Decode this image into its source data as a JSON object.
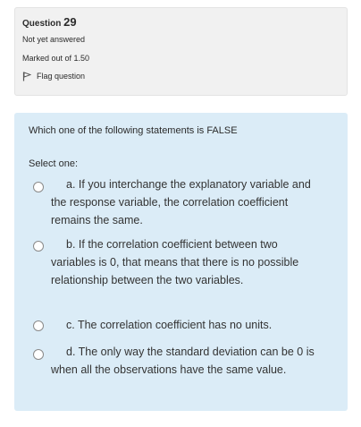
{
  "info": {
    "question_label": "Question",
    "question_number": "29",
    "status": "Not yet answered",
    "marked": "Marked out of 1.50",
    "flag_label": "Flag question"
  },
  "question": {
    "text": "Which one of the following statements is FALSE",
    "select_label": "Select one:",
    "options": [
      {
        "text": "a. If you interchange the explanatory variable and the response variable, the correlation coefficient remains the same.",
        "selected": false
      },
      {
        "text": "b. If the correlation coefficient between two variables is 0, that means that there is no possible relationship between the two variables.",
        "selected": false
      },
      {
        "text": "c. The correlation coefficient has no units.",
        "selected": false
      },
      {
        "text": "d. The only way the standard deviation can be 0 is when all the observations have the same value.",
        "selected": false
      }
    ]
  },
  "colors": {
    "info_background": "#f1f1f1",
    "question_background": "#dbecf7",
    "text": "#2b2b2b"
  },
  "icons": {
    "flag": "flag-icon",
    "radio": "radio-unchecked"
  }
}
